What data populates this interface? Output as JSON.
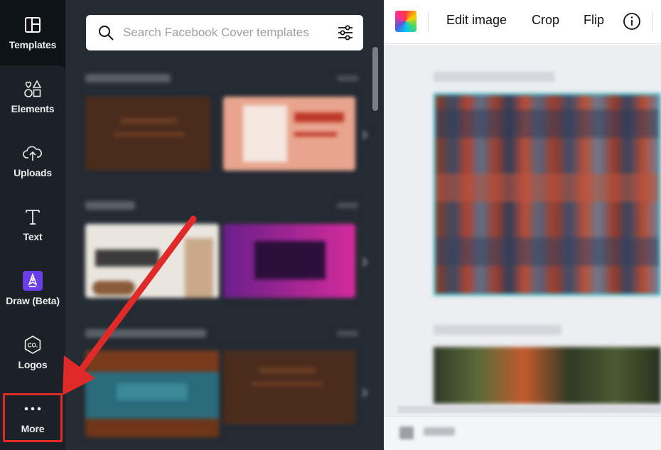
{
  "sidebar": {
    "items": [
      {
        "label": "Templates",
        "icon": "layout-icon"
      },
      {
        "label": "Elements",
        "icon": "shapes-icon"
      },
      {
        "label": "Uploads",
        "icon": "cloud-upload-icon"
      },
      {
        "label": "Text",
        "icon": "text-icon"
      },
      {
        "label": "Draw (Beta)",
        "icon": "draw-icon"
      },
      {
        "label": "Logos",
        "icon": "logo-co-icon"
      },
      {
        "label": "More",
        "icon": "ellipsis-icon"
      }
    ]
  },
  "search": {
    "placeholder": "Search Facebook Cover templates"
  },
  "toolbar": {
    "edit_image_label": "Edit image",
    "crop_label": "Crop",
    "flip_label": "Flip"
  },
  "colors": {
    "rail_bg": "#0e1318",
    "panel_bg": "#252b33",
    "highlight": "#e02a2a",
    "selection": "#3ec0cc"
  }
}
